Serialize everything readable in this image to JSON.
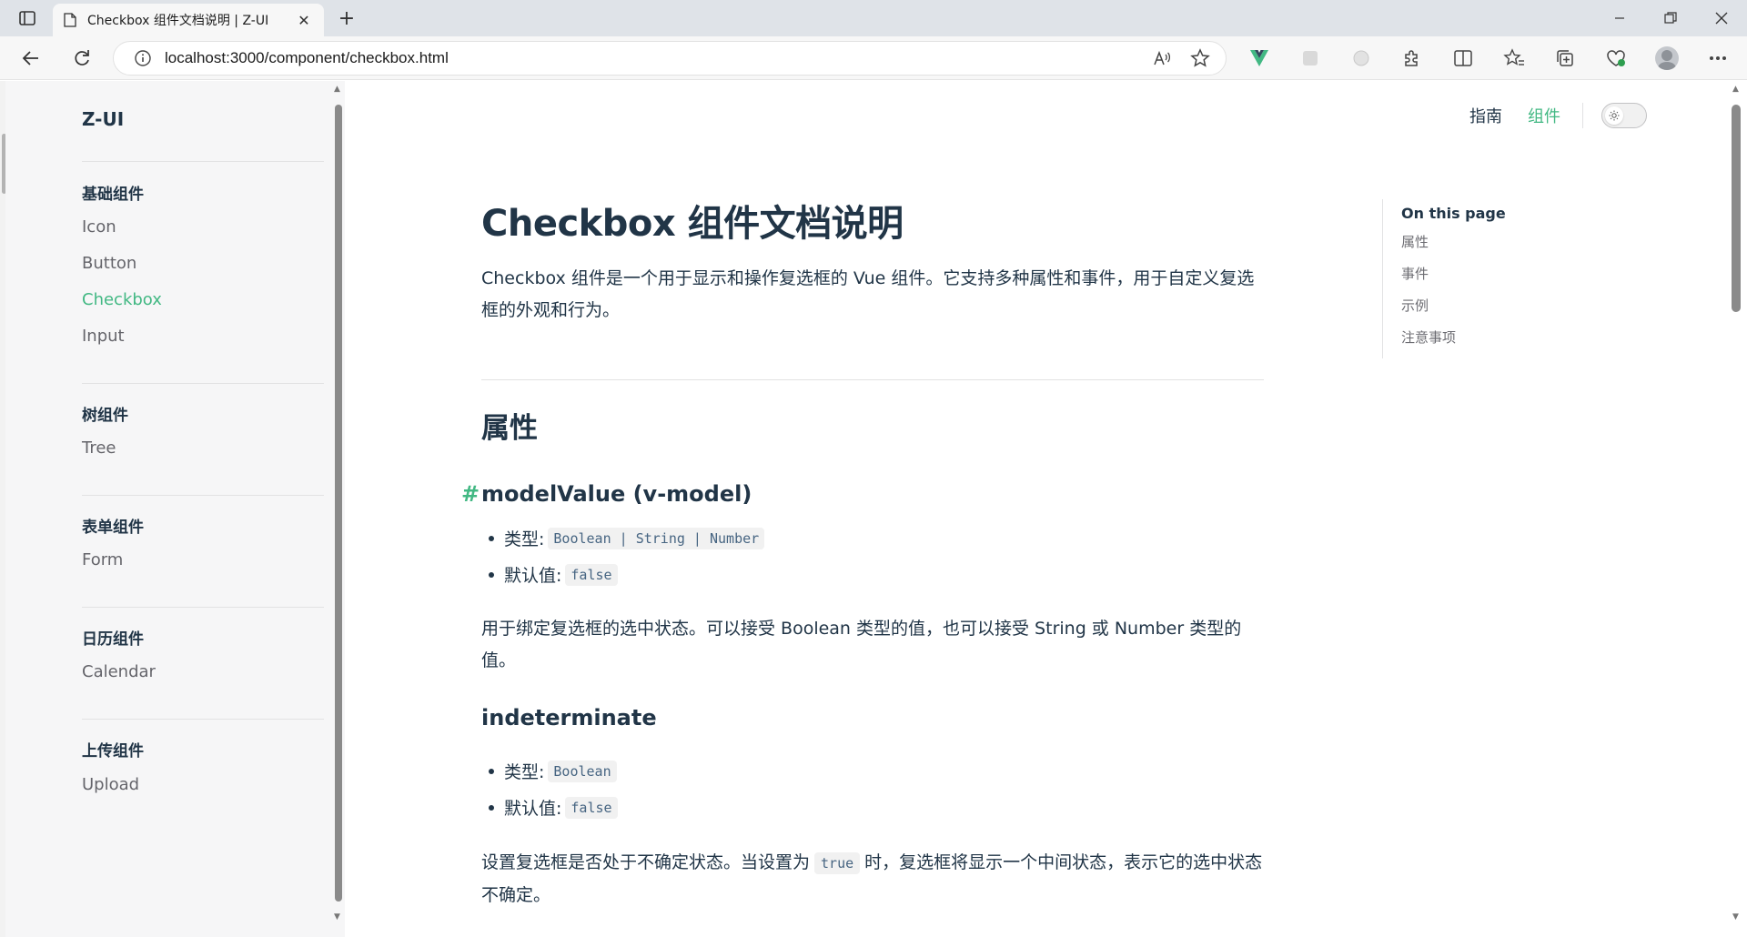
{
  "browser": {
    "tab_title": "Checkbox 组件文档说明 | Z-UI",
    "tab_close": "✕",
    "new_tab": "+",
    "url": "localhost:3000/component/checkbox.html"
  },
  "sidebar": {
    "logo": "Z-UI",
    "groups": [
      {
        "title": "基础组件",
        "items": [
          "Icon",
          "Button",
          "Checkbox",
          "Input"
        ]
      },
      {
        "title": "树组件",
        "items": [
          "Tree"
        ]
      },
      {
        "title": "表单组件",
        "items": [
          "Form"
        ]
      },
      {
        "title": "日历组件",
        "items": [
          "Calendar"
        ]
      },
      {
        "title": "上传组件",
        "items": [
          "Upload"
        ]
      }
    ],
    "active_item": "Checkbox"
  },
  "topnav": {
    "guide": "指南",
    "components": "组件",
    "active": "组件"
  },
  "doc": {
    "title": "Checkbox 组件文档说明",
    "intro": "Checkbox 组件是一个用于显示和操作复选框的 Vue 组件。它支持多种属性和事件，用于自定义复选框的外观和行为。",
    "section_attrs": "属性",
    "anchor": "#",
    "props": [
      {
        "name": "modelValue (v-model)",
        "type_label": "类型:",
        "type_value": "Boolean | String | Number",
        "default_label": "默认值:",
        "default_value": "false",
        "desc": "用于绑定复选框的选中状态。可以接受 Boolean 类型的值，也可以接受 String 或 Number 类型的值。"
      },
      {
        "name": "indeterminate",
        "type_label": "类型:",
        "type_value": "Boolean",
        "default_label": "默认值:",
        "default_value": "false",
        "desc_before": "设置复选框是否处于不确定状态。当设置为",
        "desc_code": "true",
        "desc_after": "时，复选框将显示一个中间状态，表示它的选中状态不确定。"
      }
    ]
  },
  "outline": {
    "title": "On this page",
    "items": [
      "属性",
      "事件",
      "示例",
      "注意事项"
    ]
  },
  "colors": {
    "brand": "#42b883",
    "text": "#213547",
    "sidebar_bg": "#f6f6f7"
  }
}
